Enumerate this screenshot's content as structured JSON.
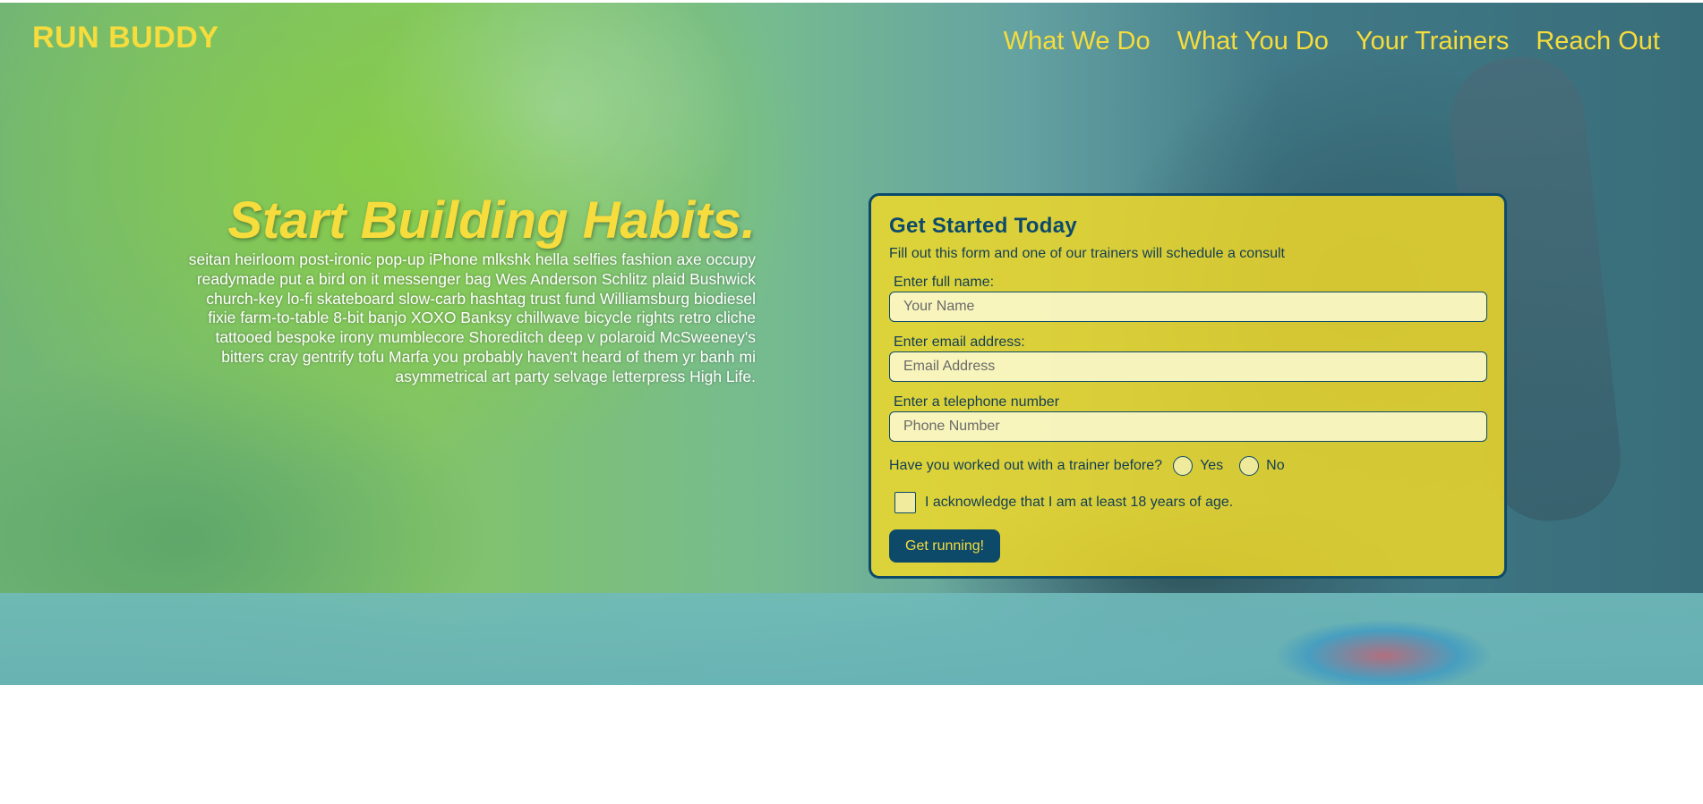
{
  "header": {
    "logo": "RUN BUDDY",
    "nav": [
      "What We Do",
      "What You Do",
      "Your Trainers",
      "Reach Out"
    ]
  },
  "hero": {
    "headline": "Start Building Habits.",
    "intro": "seitan heirloom post-ironic pop-up iPhone mlkshk hella selfies fashion axe occupy readymade put a bird on it messenger bag Wes Anderson Schlitz plaid Bushwick church-key lo-fi skateboard slow-carb hashtag trust fund Williamsburg biodiesel fixie farm-to-table 8-bit banjo XOXO Banksy chillwave bicycle rights retro cliche tattooed bespoke irony mumblecore Shoreditch deep v polaroid McSweeney's bitters cray gentrify tofu Marfa you probably haven't heard of them yr banh mi asymmetrical art party selvage letterpress High Life."
  },
  "form": {
    "title": "Get Started Today",
    "subtitle": "Fill out this form and one of our trainers will schedule a consult",
    "name_label": "Enter full name:",
    "name_placeholder": "Your Name",
    "email_label": "Enter email address:",
    "email_placeholder": "Email Address",
    "phone_label": "Enter a telephone number",
    "phone_placeholder": "Phone Number",
    "trainer_question": "Have you worked out with a trainer before?",
    "option_yes": "Yes",
    "option_no": "No",
    "acknowledge": "I acknowledge that I am at least 18 years of age.",
    "submit": "Get running!"
  },
  "colors": {
    "accent": "#f6dc3c",
    "primary": "#0d4a6a",
    "card": "#f0d828"
  }
}
